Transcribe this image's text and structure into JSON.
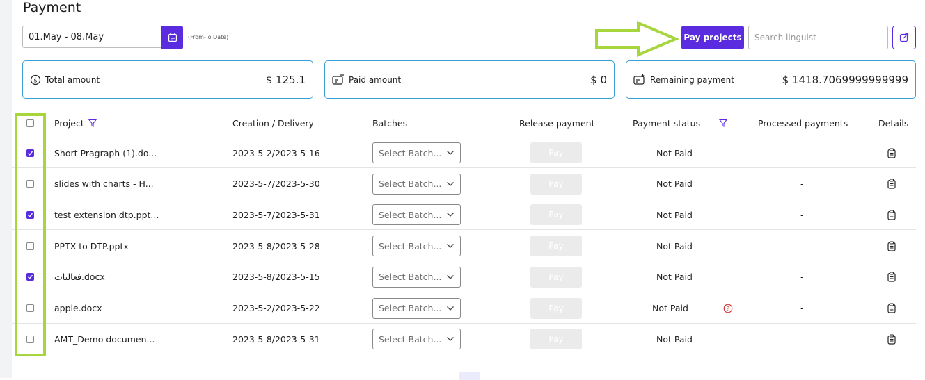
{
  "page": {
    "title": "Payment"
  },
  "filters": {
    "date_range": "01.May - 08.May",
    "date_hint": "(From-To Date)",
    "pay_projects_label": "Pay projects",
    "search_placeholder": "Search linguist"
  },
  "summary": [
    {
      "label": "Total amount",
      "value": "$ 125.1",
      "icon": "dollar-circle-icon"
    },
    {
      "label": "Paid amount",
      "value": "$ 0",
      "icon": "paid-card-icon"
    },
    {
      "label": "Remaining payment",
      "value": "$ 1418.7069999999999",
      "icon": "remaining-card-icon"
    }
  ],
  "table": {
    "columns": {
      "project": "Project",
      "dates": "Creation / Delivery",
      "batches": "Batches",
      "release": "Release payment",
      "status": "Payment status",
      "processed": "Processed payments",
      "details": "Details"
    },
    "rows": [
      {
        "checked": true,
        "project": "Short Pragraph (1).do...",
        "dates": "2023-5-2/2023-5-16",
        "batch": "Select Batch...",
        "pay": "Pay",
        "status": "Not Paid",
        "warning": false,
        "processed": "-"
      },
      {
        "checked": false,
        "project": "slides with charts - H...",
        "dates": "2023-5-7/2023-5-30",
        "batch": "Select Batch...",
        "pay": "Pay",
        "status": "Not Paid",
        "warning": false,
        "processed": "-"
      },
      {
        "checked": true,
        "project": "test extension dtp.ppt...",
        "dates": "2023-5-7/2023-5-31",
        "batch": "Select Batch...",
        "pay": "Pay",
        "status": "Not Paid",
        "warning": false,
        "processed": "-"
      },
      {
        "checked": false,
        "project": "PPTX to DTP.pptx",
        "dates": "2023-5-8/2023-5-28",
        "batch": "Select Batch...",
        "pay": "Pay",
        "status": "Not Paid",
        "warning": false,
        "processed": "-"
      },
      {
        "checked": true,
        "project": "فعاليات.docx",
        "dates": "2023-5-8/2023-5-15",
        "batch": "Select Batch...",
        "pay": "Pay",
        "status": "Not Paid",
        "warning": false,
        "processed": "-"
      },
      {
        "checked": false,
        "project": "apple.docx",
        "dates": "2023-5-2/2023-5-22",
        "batch": "Select Batch...",
        "pay": "Pay",
        "status": "Not Paid",
        "warning": true,
        "processed": "-"
      },
      {
        "checked": false,
        "project": "AMT_Demo documen...",
        "dates": "2023-5-8/2023-5-31",
        "batch": "Select Batch...",
        "pay": "Pay",
        "status": "Not Paid",
        "warning": false,
        "processed": "-"
      }
    ]
  },
  "colors": {
    "accent": "#5b2be0",
    "annotation": "#a7d63c",
    "card_border": "#3aa0d8",
    "warning": "#d62c2c"
  }
}
